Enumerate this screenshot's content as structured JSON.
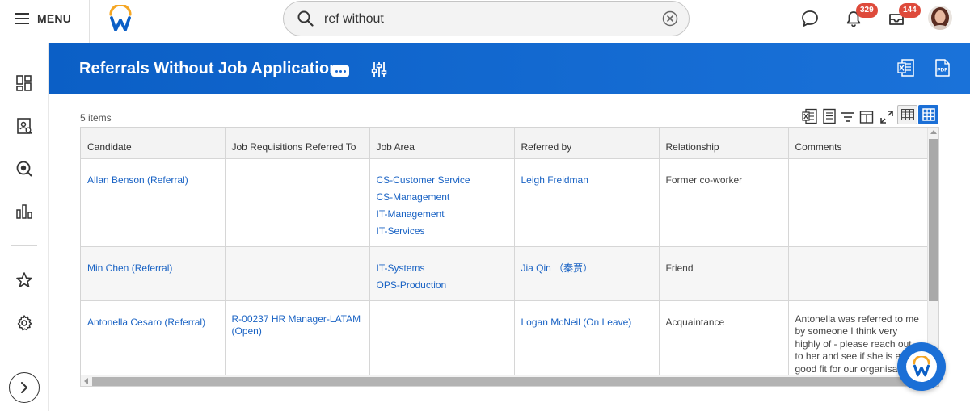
{
  "header": {
    "menu_label": "MENU",
    "search_value": "ref without",
    "notifications_count": "329",
    "inbox_count": "144"
  },
  "report": {
    "title": "Referrals Without Job Applications",
    "items_count": "5 items"
  },
  "columns": [
    "Candidate",
    "Job Requisitions Referred To",
    "Job Area",
    "Referred by",
    "Relationship",
    "Comments"
  ],
  "rows": [
    {
      "candidate": "Allan Benson (Referral)",
      "requisition": "",
      "job_area": [
        "CS-Customer Service",
        "CS-Management",
        "IT-Management",
        "IT-Services"
      ],
      "referred_by": "Leigh Freidman",
      "relationship": "Former co-worker",
      "comments": ""
    },
    {
      "candidate": "Min Chen (Referral)",
      "requisition": "",
      "job_area": [
        "IT-Systems",
        "OPS-Production"
      ],
      "referred_by": "Jia Qin （秦贾）",
      "relationship": "Friend",
      "comments": ""
    },
    {
      "candidate": "Antonella Cesaro (Referral)",
      "requisition": "R-00237 HR Manager-LATAM (Open)",
      "job_area": [],
      "referred_by": "Logan McNeil (On Leave)",
      "relationship": "Acquaintance",
      "comments": "Antonella was referred to me by someone I think very highly of - please reach out to her and see if she is a good fit for our organisation."
    }
  ],
  "colors": {
    "banner": "#1a67cf",
    "link": "#1a63c4",
    "badge": "#de4a3b",
    "accent_orange": "#f5a623"
  },
  "icons": {
    "header": [
      "hamburger-icon",
      "workday-logo",
      "search-icon",
      "clear-icon",
      "chat-icon",
      "bell-icon",
      "inbox-icon"
    ],
    "rail": [
      "dashboard-icon",
      "profile-icon",
      "search-report-icon",
      "chart-icon",
      "star-icon",
      "gear-icon",
      "chevron-right-icon"
    ],
    "banner": [
      "more-icon",
      "tune-icon",
      "excel-icon",
      "pdf-icon"
    ],
    "toolbar": [
      "export-excel-icon",
      "print-icon",
      "filter-icon",
      "columns-icon",
      "fullscreen-icon",
      "table-view-icon",
      "grid-view-icon"
    ]
  }
}
